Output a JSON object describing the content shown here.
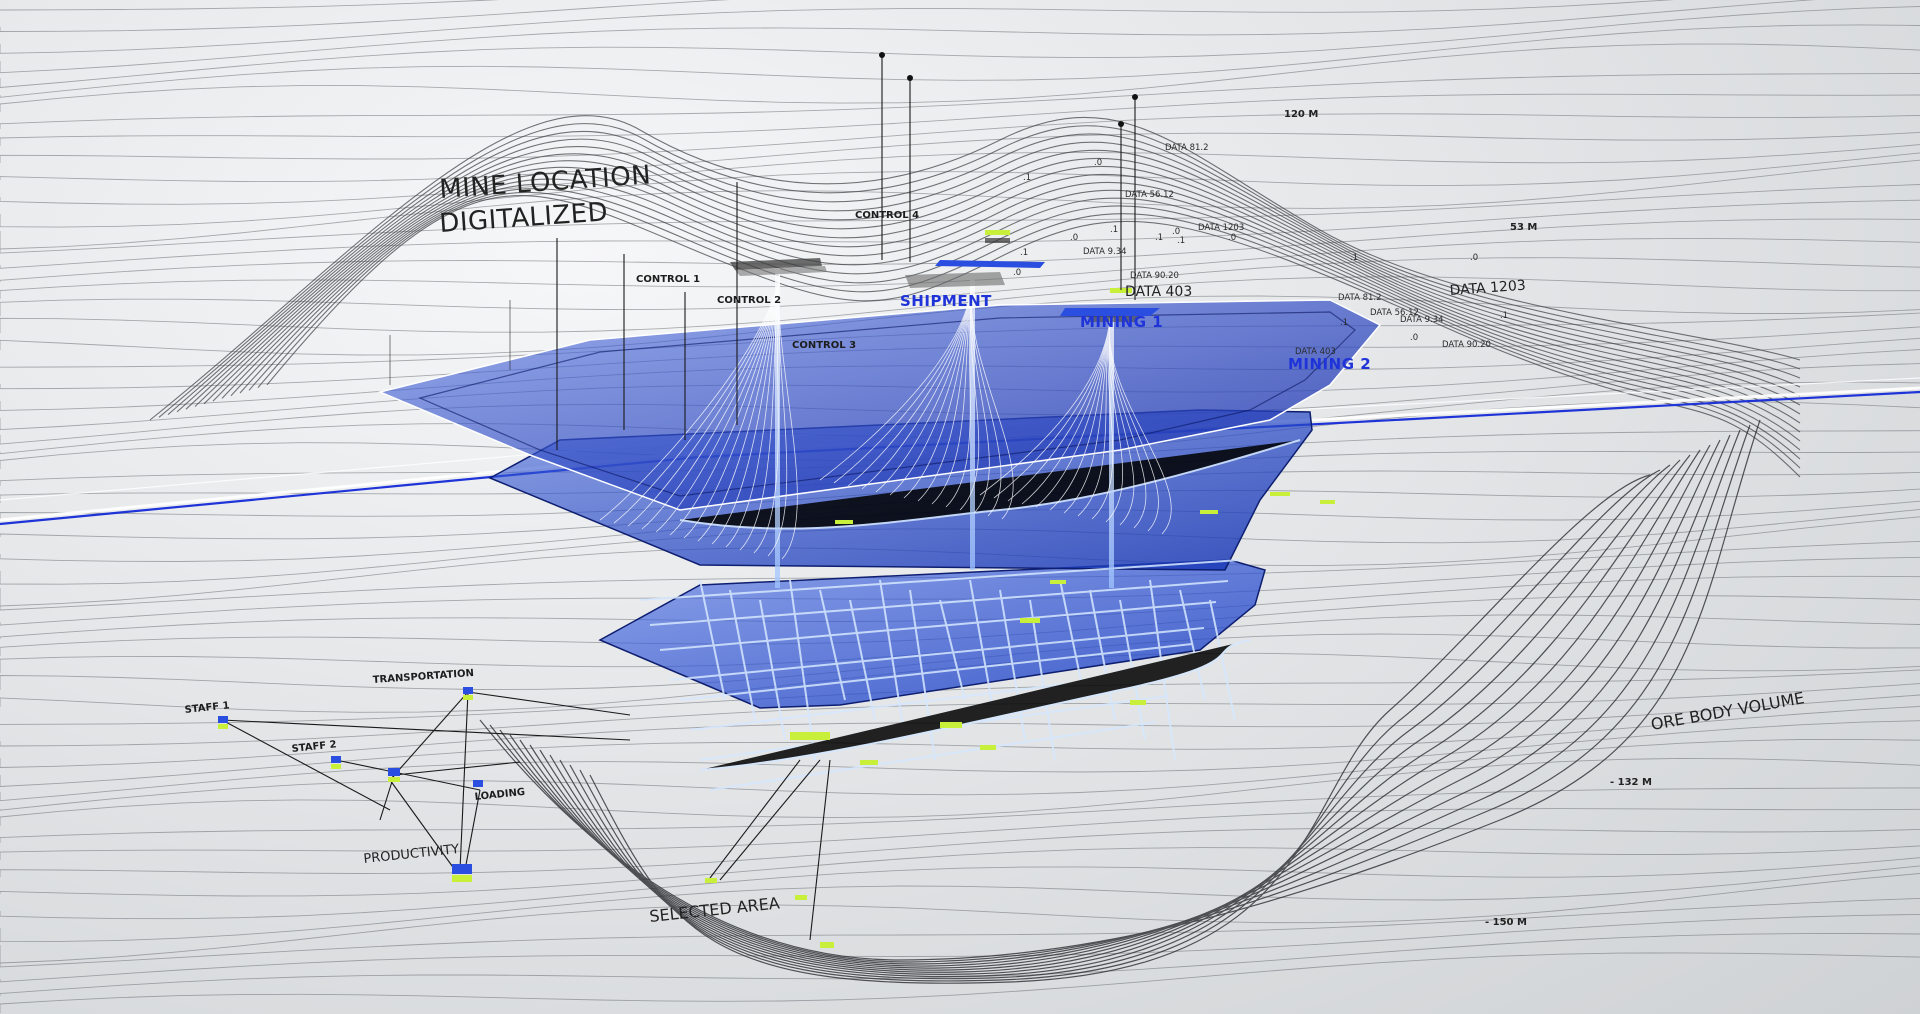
{
  "title": {
    "line1": "MINE LOCATION",
    "line2": "DIGITALIZED"
  },
  "controls": [
    "CONTROL 1",
    "CONTROL 2",
    "CONTROL 3",
    "CONTROL 4"
  ],
  "nodes": {
    "shipment": "SHIPMENT",
    "mining1": "MINING 1",
    "mining2": "MINING 2"
  },
  "data_labels": {
    "data_403_large": "DATA 403",
    "data_1203_large": "DATA 1203",
    "data_81_2": "DATA 81.2",
    "data_56_12": "DATA 56.12",
    "data_1203": "DATA 1203",
    "data_9_34": "DATA 9.34",
    "data_90_20": "DATA 90.20",
    "data_81_2_b": "DATA 81.2",
    "data_56_12_b": "DATA 56.12",
    "data_9_34_b": "DATA 9.34",
    "data_403_small": "DATA 403",
    "data_90_20_b": "DATA 90.20"
  },
  "scatter_values": [
    ".1",
    ".0",
    ".1",
    ".0",
    ".1",
    ".0",
    ".1",
    ".0",
    ".1",
    ".0",
    ".1",
    ".0",
    ".1",
    ".0",
    ".1"
  ],
  "depths": {
    "d120": "120 M",
    "d53": "53 M",
    "d132": "- 132 M",
    "d150": "- 150 M"
  },
  "network": {
    "staff1": "STAFF 1",
    "staff2": "STAFF 2",
    "transportation": "TRANSPORTATION",
    "loading": "LOADING",
    "productivity": "PRODUCTIVITY",
    "selected_area": "SELECTED AREA"
  },
  "ore_body": "ORE BODY VOLUME",
  "colors": {
    "layer_blue": "#1f3fbf",
    "accent_blue": "#1e33d8",
    "highlight_green": "#c8f03a",
    "node_blue": "#2a4fe0"
  }
}
